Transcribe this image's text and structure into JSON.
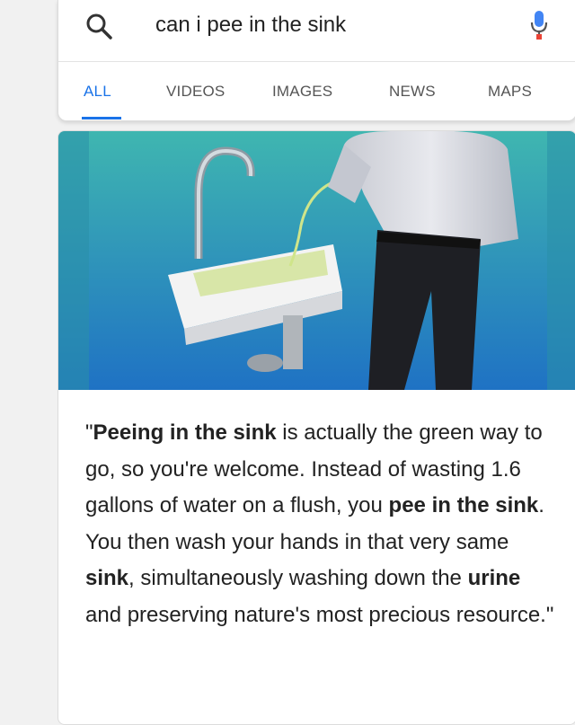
{
  "search": {
    "query": "can i pee in the sink",
    "icons": {
      "search": "search-icon",
      "mic": "microphone-icon"
    }
  },
  "tabs": [
    {
      "label": "ALL",
      "active": true
    },
    {
      "label": "VIDEOS",
      "active": false
    },
    {
      "label": "IMAGES",
      "active": false
    },
    {
      "label": "NEWS",
      "active": false
    },
    {
      "label": "MAPS",
      "active": false
    }
  ],
  "result": {
    "quote_segments": [
      {
        "text": "\"",
        "bold": false
      },
      {
        "text": "Peeing in the sink",
        "bold": true
      },
      {
        "text": " is actually the green way to go, so you're welcome. Instead of wasting 1.6 gallons of water on a flush, you ",
        "bold": false
      },
      {
        "text": "pee in the sink",
        "bold": true
      },
      {
        "text": ". You then wash your hands in that very same ",
        "bold": false
      },
      {
        "text": "sink",
        "bold": true
      },
      {
        "text": ", simultaneously washing down the ",
        "bold": false
      },
      {
        "text": "urine",
        "bold": true
      },
      {
        "text": " and preserving nature's most precious resource.\"",
        "bold": false
      }
    ]
  },
  "colors": {
    "accent": "#1a73e8",
    "illustration_bg_top": "#3fb6b0",
    "illustration_bg_bottom": "#1f72c4"
  }
}
